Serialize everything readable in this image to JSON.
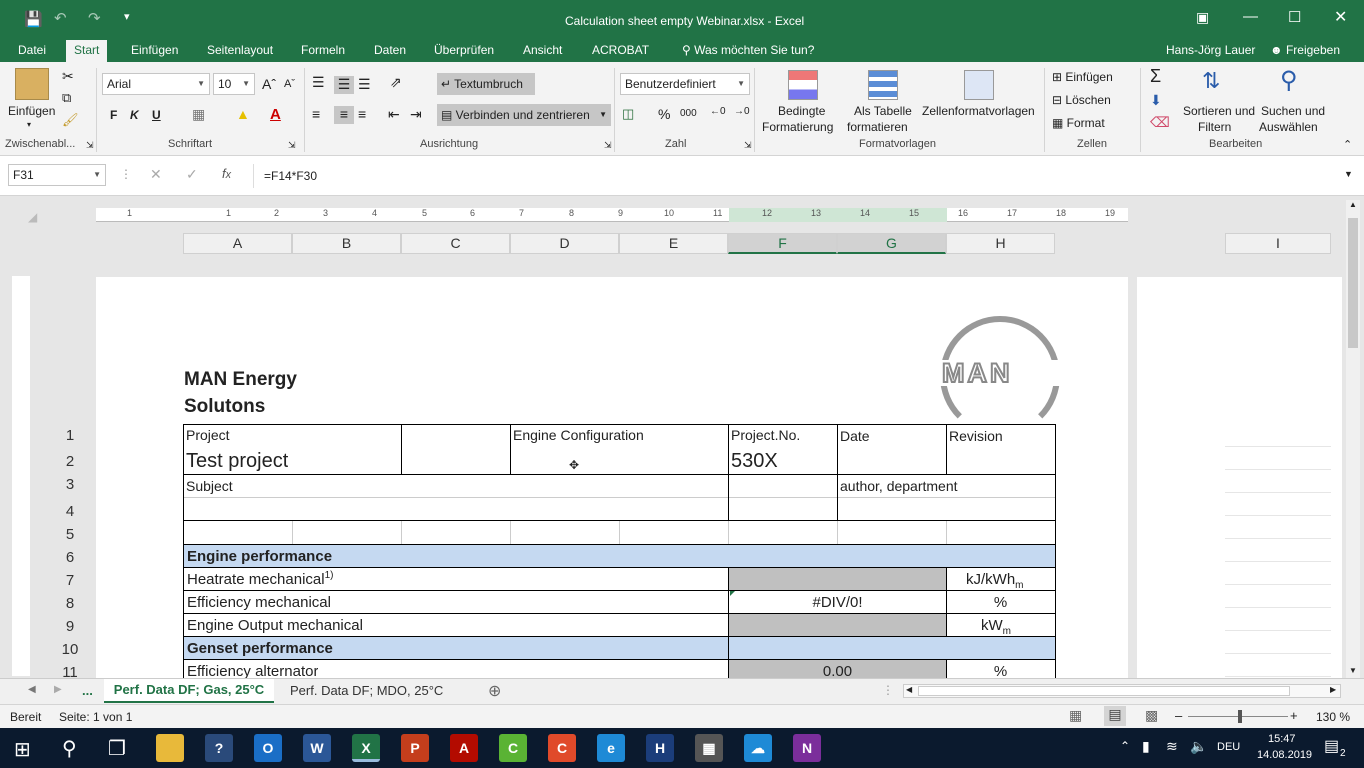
{
  "window": {
    "title": "Calculation sheet empty Webinar.xlsx - Excel"
  },
  "ribbon_tabs": [
    "Datei",
    "Start",
    "Einfügen",
    "Seitenlayout",
    "Formeln",
    "Daten",
    "Überprüfen",
    "Ansicht",
    "ACROBAT",
    "Was möchten Sie tun?"
  ],
  "user": {
    "name": "Hans-Jörg Lauer",
    "share": "Freigeben"
  },
  "ribbon": {
    "paste": "Einfügen",
    "font_name": "Arial",
    "font_size": "10",
    "bold": "F",
    "italic": "K",
    "underline": "U",
    "wrap": "Textumbruch",
    "merge": "Verbinden und zentrieren",
    "number_format": "Benutzerdefiniert",
    "cond_format_1": "Bedingte",
    "cond_format_2": "Formatierung",
    "table_1": "Als Tabelle",
    "table_2": "formatieren",
    "cell_styles": "Zellenformatvorlagen",
    "insert": "Einfügen",
    "delete": "Löschen",
    "format": "Format",
    "sort_1": "Sortieren und",
    "sort_2": "Filtern",
    "find_1": "Suchen und",
    "find_2": "Auswählen",
    "groups": {
      "clipboard": "Zwischenabl...",
      "font": "Schriftart",
      "align": "Ausrichtung",
      "number": "Zahl",
      "styles": "Formatvorlagen",
      "cells": "Zellen",
      "edit": "Bearbeiten"
    }
  },
  "formula_bar": {
    "name_box": "F31",
    "formula": "=F14*F30"
  },
  "columns": [
    "A",
    "B",
    "C",
    "D",
    "E",
    "F",
    "G",
    "H",
    "I"
  ],
  "ruler": [
    "1",
    "1",
    "2",
    "3",
    "4",
    "5",
    "6",
    "7",
    "8",
    "9",
    "10",
    "11",
    "12",
    "13",
    "14",
    "15",
    "16",
    "17",
    "18",
    "19"
  ],
  "sheet": {
    "company_1": "MAN Energy",
    "company_2": "Solutons",
    "logo_text": "MAN",
    "project_label": "Project",
    "engine_config_label": "Engine Configuration",
    "project_no_label": "Project.No.",
    "date_label": "Date",
    "revision_label": "Revision",
    "project_value": "Test project",
    "project_no_value": "530X",
    "subject_label": "Subject",
    "author_label": "author, department",
    "engine_perf": "Engine performance",
    "heatrate": "Heatrate mechanical",
    "heatrate_sup": "1)",
    "heatrate_unit": "kJ/kWh",
    "heatrate_unit_sub": "m",
    "efficiency": "Efficiency mechanical",
    "efficiency_value": "#DIV/0!",
    "efficiency_unit": "%",
    "output": "Engine Output mechanical",
    "output_unit": "kW",
    "output_unit_sub": "m",
    "genset_perf": "Genset performance",
    "alt_eff": "Efficiency alternator",
    "alt_eff_value": "0.00",
    "alt_eff_unit": "%",
    "rows": [
      "1",
      "2",
      "3",
      "4",
      "5",
      "6",
      "7",
      "8",
      "9",
      "10",
      "11"
    ]
  },
  "sheet_tabs": {
    "more": "...",
    "active": "Perf. Data DF; Gas, 25°C",
    "other": "Perf. Data DF; MDO, 25°C"
  },
  "status": {
    "ready": "Bereit",
    "page": "Seite: 1 von 1",
    "zoom": "130 %"
  },
  "taskbar": {
    "lang": "DEU",
    "time": "15:47",
    "date": "14.08.2019",
    "notif": "2"
  }
}
